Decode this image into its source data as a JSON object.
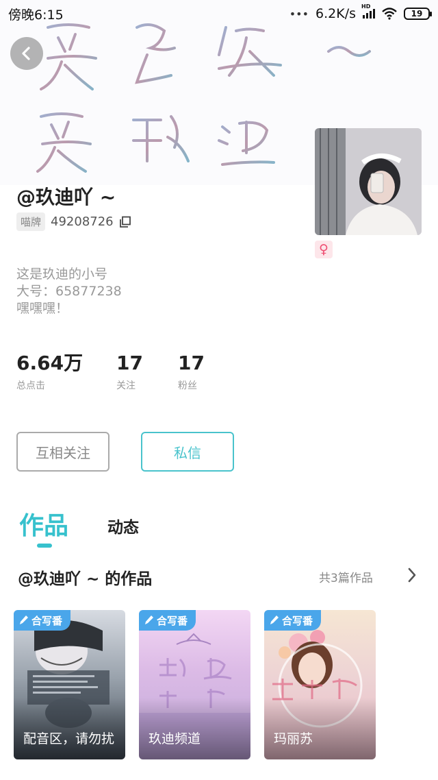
{
  "status_bar": {
    "time": "傍晚6:15",
    "dots": "•••",
    "network_speed": "6.2K/s",
    "signal_label": "HD",
    "battery_level": "19"
  },
  "banner": {
    "handwriting_line1": "爱兔役 ~",
    "handwriting_line2": "爱玖迪"
  },
  "profile": {
    "nickname": "@玖迪吖 ~",
    "id_badge": "喵牌",
    "id_value": "49208726",
    "gender": "♀",
    "bio_lines": [
      "这是玖迪的小号",
      "大号：65877238",
      "嘿嘿嘿！"
    ]
  },
  "stats": [
    {
      "value": "6.64万",
      "label": "总点击"
    },
    {
      "value": "17",
      "label": "关注"
    },
    {
      "value": "17",
      "label": "粉丝"
    }
  ],
  "actions": {
    "follow_label": "互相关注",
    "message_label": "私信"
  },
  "tabs": [
    {
      "label": "作品",
      "active": true
    },
    {
      "label": "动态",
      "active": false
    }
  ],
  "works": {
    "title": "@玖迪吖 ~ 的作品",
    "count_label": "共3篇作品",
    "items": [
      {
        "tag": "合写番",
        "title": "配音区，请勿扰"
      },
      {
        "tag": "合写番",
        "title": "玖迪频道"
      },
      {
        "tag": "合写番",
        "title": "玛丽苏"
      }
    ]
  },
  "colors": {
    "accent": "#37c1cd",
    "tag_blue": "#4aa6ea",
    "gender_pink": "#ef4f73"
  }
}
